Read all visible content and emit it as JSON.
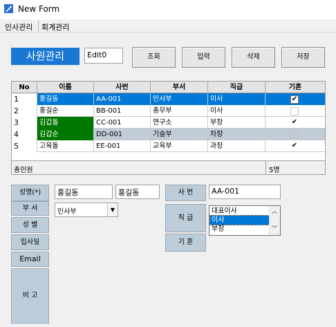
{
  "window": {
    "title": "New Form"
  },
  "menu": {
    "items": [
      "인사관리",
      "회계관리"
    ]
  },
  "header": {
    "title": "사원관리",
    "edit_value": "Edit0"
  },
  "toolbar": {
    "buttons": [
      "조회",
      "입력",
      "삭제",
      "저장"
    ]
  },
  "grid": {
    "columns": [
      "No",
      "이름",
      "사번",
      "부서",
      "직급",
      "기혼"
    ],
    "rows": [
      {
        "no": "1",
        "name": "홍길동",
        "id": "AA-001",
        "dept": "인사부",
        "rank": "이사",
        "married": true
      },
      {
        "no": "2",
        "name": "홍길순",
        "id": "BB-001",
        "dept": "총무부",
        "rank": "이사",
        "married": false
      },
      {
        "no": "3",
        "name": "김갑돌",
        "id": "CC-001",
        "dept": "연구소",
        "rank": "부장",
        "married": true
      },
      {
        "no": "4",
        "name": "김갑순",
        "id": "DD-001",
        "dept": "기술부",
        "rank": "차장",
        "married": false
      },
      {
        "no": "5",
        "name": "고육돌",
        "id": "EE-001",
        "dept": "교육부",
        "rank": "과장",
        "married": true
      }
    ],
    "footer_left": "총인원",
    "footer_right": "5명"
  },
  "form": {
    "labels": {
      "name": "성명(*)",
      "dept": "부 서",
      "gender": "성 별",
      "join_date": "입사일",
      "email": "Email",
      "note": "비 고",
      "emp_id": "사 번",
      "rank": "직 급",
      "married": "기 혼"
    },
    "name_value": "홍길동",
    "name_value2": "홍길동",
    "dept_value": "인사부",
    "emp_id_value": "AA-001",
    "rank_options": [
      "대표이사",
      "이사",
      "부장"
    ]
  },
  "colors": {
    "accent": "#1a78d4",
    "selected_row": "#0078d7",
    "alt_row": "#c0ccd8",
    "name_green": "#007800",
    "label_bg": "#bcccd8",
    "list_selected": "#0078d7"
  }
}
